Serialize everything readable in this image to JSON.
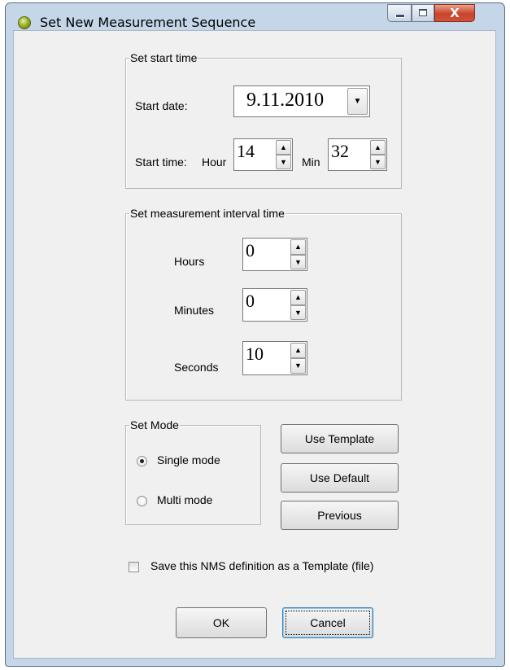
{
  "window": {
    "title": "Set New Measurement Sequence",
    "icons": {
      "app": "app-icon",
      "minimize": "minimize-icon",
      "maximize": "maximize-icon",
      "close": "close-icon"
    },
    "close_glyph": "X"
  },
  "start_group": {
    "legend": "Set start time",
    "start_date_label": "Start date:",
    "start_date_value": "9.11.2010",
    "start_time_label": "Start time:",
    "hour_label": "Hour",
    "hour_value": "14",
    "min_label": "Min",
    "min_value": "32"
  },
  "interval_group": {
    "legend": "Set measurement interval time",
    "hours_label": "Hours",
    "hours_value": "0",
    "minutes_label": "Minutes",
    "minutes_value": "0",
    "seconds_label": "Seconds",
    "seconds_value": "10"
  },
  "mode_group": {
    "legend": "Set Mode",
    "single_label": "Single mode",
    "multi_label": "Multi mode",
    "selected": "single"
  },
  "buttons": {
    "use_template": "Use Template",
    "use_default": "Use Default",
    "previous": "Previous",
    "ok": "OK",
    "cancel": "Cancel"
  },
  "save_template": {
    "label": "Save this NMS definition as a Template (file)",
    "checked": false
  }
}
